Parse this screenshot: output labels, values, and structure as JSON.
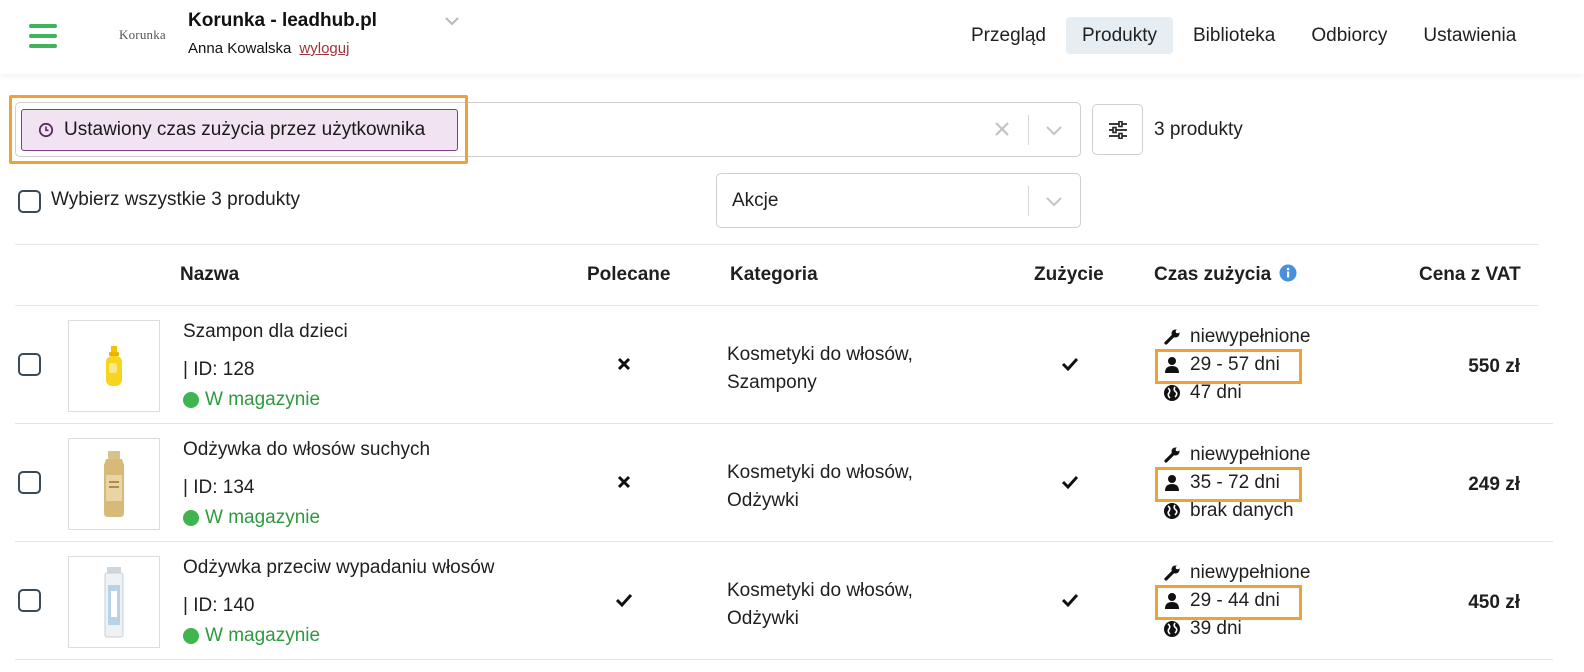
{
  "header": {
    "brand_logo_text": "Korunka",
    "title": "Korunka - leadhub.pl",
    "user_name": "Anna Kowalska",
    "logout_label": "wyloguj",
    "nav": [
      {
        "label": "Przegląd",
        "active": false
      },
      {
        "label": "Produkty",
        "active": true
      },
      {
        "label": "Biblioteka",
        "active": false
      },
      {
        "label": "Odbiorcy",
        "active": false
      },
      {
        "label": "Ustawienia",
        "active": false
      }
    ]
  },
  "filter": {
    "tag_label": "Ustawiony czas zużycia przez użytkownika",
    "count_text": "3 produkty"
  },
  "bulk": {
    "select_all_label": "Wybierz wszystkie 3 produkty",
    "actions_value": "Akcje"
  },
  "table": {
    "columns": {
      "name": "Nazwa",
      "recommended": "Polecane",
      "category": "Kategoria",
      "usage": "Zużycie",
      "usage_time": "Czas zużycia",
      "price": "Cena z VAT"
    },
    "rows": [
      {
        "name": "Szampon dla dzieci",
        "id_text": "| ID: 128",
        "stock": "W magazynie",
        "recommended": false,
        "category_line1": "Kosmetyki do włosów,",
        "category_line2": "Szampony",
        "usage": true,
        "time_manual": "niewypełnione",
        "time_user": "29 - 57 dni",
        "time_global": "47 dni",
        "price": "550 zł"
      },
      {
        "name": "Odżywka do włosów suchych",
        "id_text": "| ID: 134",
        "stock": "W magazynie",
        "recommended": false,
        "category_line1": "Kosmetyki do włosów,",
        "category_line2": "Odżywki",
        "usage": true,
        "time_manual": "niewypełnione",
        "time_user": "35 - 72 dni",
        "time_global": "brak danych",
        "price": "249 zł"
      },
      {
        "name": "Odżywka przeciw wypadaniu włosów",
        "id_text": "| ID: 140",
        "stock": "W magazynie",
        "recommended": true,
        "category_line1": "Kosmetyki do włosów,",
        "category_line2": "Odżywki",
        "usage": true,
        "time_manual": "niewypełnione",
        "time_user": "29 - 44 dni",
        "time_global": "39 dni",
        "price": "450 zł"
      }
    ]
  },
  "colors": {
    "accent_green": "#3fb45a",
    "tag_bg": "#f2e3f2",
    "tag_border": "#7d3f86",
    "highlight_orange": "#f0a036",
    "info_blue": "#4a90d9",
    "stock_green": "#2e9a3f",
    "logout_red": "#a0343e"
  },
  "icons": {
    "menu": "hamburger-icon",
    "clock": "clock-icon",
    "clear": "close-icon",
    "dropdown": "chevron-down-icon",
    "settings": "sliders-icon",
    "info": "info-icon",
    "manual": "wrench-icon",
    "user": "user-icon",
    "global": "globe-icon",
    "yes": "check-icon",
    "no": "cross-icon"
  }
}
